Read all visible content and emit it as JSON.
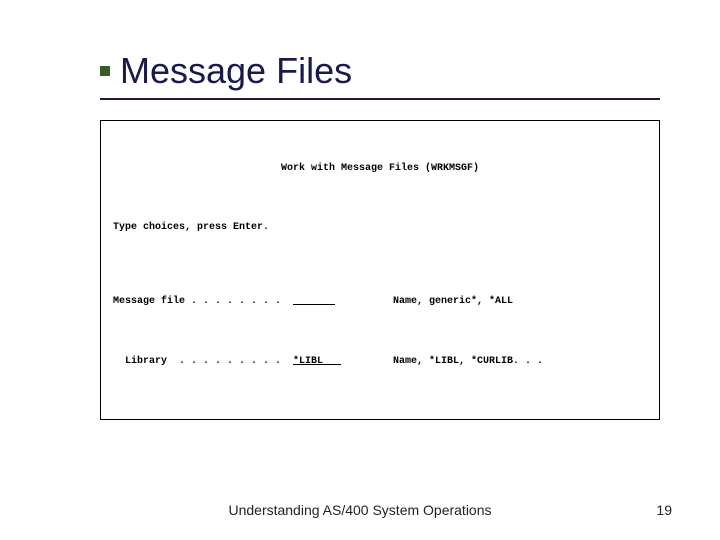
{
  "slide": {
    "title": "Message Files",
    "footer": "Understanding AS/400 System Operations",
    "page_number": "19"
  },
  "terminal": {
    "header": "Work with Message Files (WRKMSGF)",
    "instruction": "Type choices, press Enter.",
    "rows": [
      {
        "label": "Message file . . . . . . . .",
        "value": "       ",
        "hint": "Name, generic*, *ALL"
      },
      {
        "label": "  Library  . . . . . . . . .",
        "value": "*LIBL   ",
        "hint": "Name, *LIBL, *CURLIB. . ."
      }
    ]
  }
}
